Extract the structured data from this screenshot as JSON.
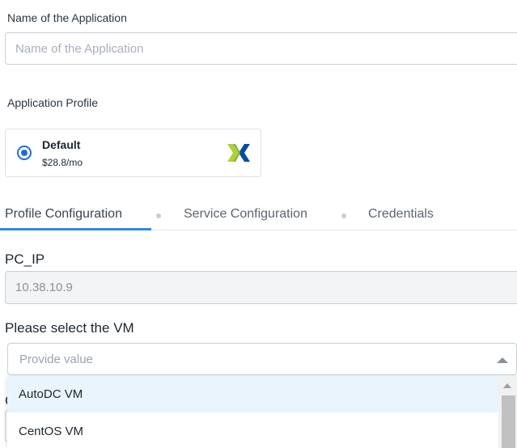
{
  "app_name": {
    "label": "Name of the Application",
    "placeholder": "Name of the Application",
    "value": ""
  },
  "application_profile": {
    "label": "Application Profile",
    "profiles": [
      {
        "name": "Default",
        "price": "$28.8/mo",
        "selected": true,
        "icon": "nutanix-logo-icon"
      }
    ]
  },
  "tabs": [
    {
      "label": "Profile Configuration",
      "active": true
    },
    {
      "label": "Service Configuration",
      "active": false
    },
    {
      "label": "Credentials",
      "active": false
    }
  ],
  "pc_ip": {
    "label": "PC_IP",
    "value": "10.38.10.9"
  },
  "vm_select": {
    "label": "Please select the VM",
    "placeholder": "Provide value",
    "expanded": true,
    "options": [
      "AutoDC VM",
      "CentOS VM"
    ],
    "hovered_option": "AutoDC VM"
  },
  "colors": {
    "accent": "#2a8be0",
    "radio": "#1f6fd1",
    "hover_bg": "#eaf4fd",
    "logo_green": "#afd135",
    "logo_blue": "#024da1"
  }
}
